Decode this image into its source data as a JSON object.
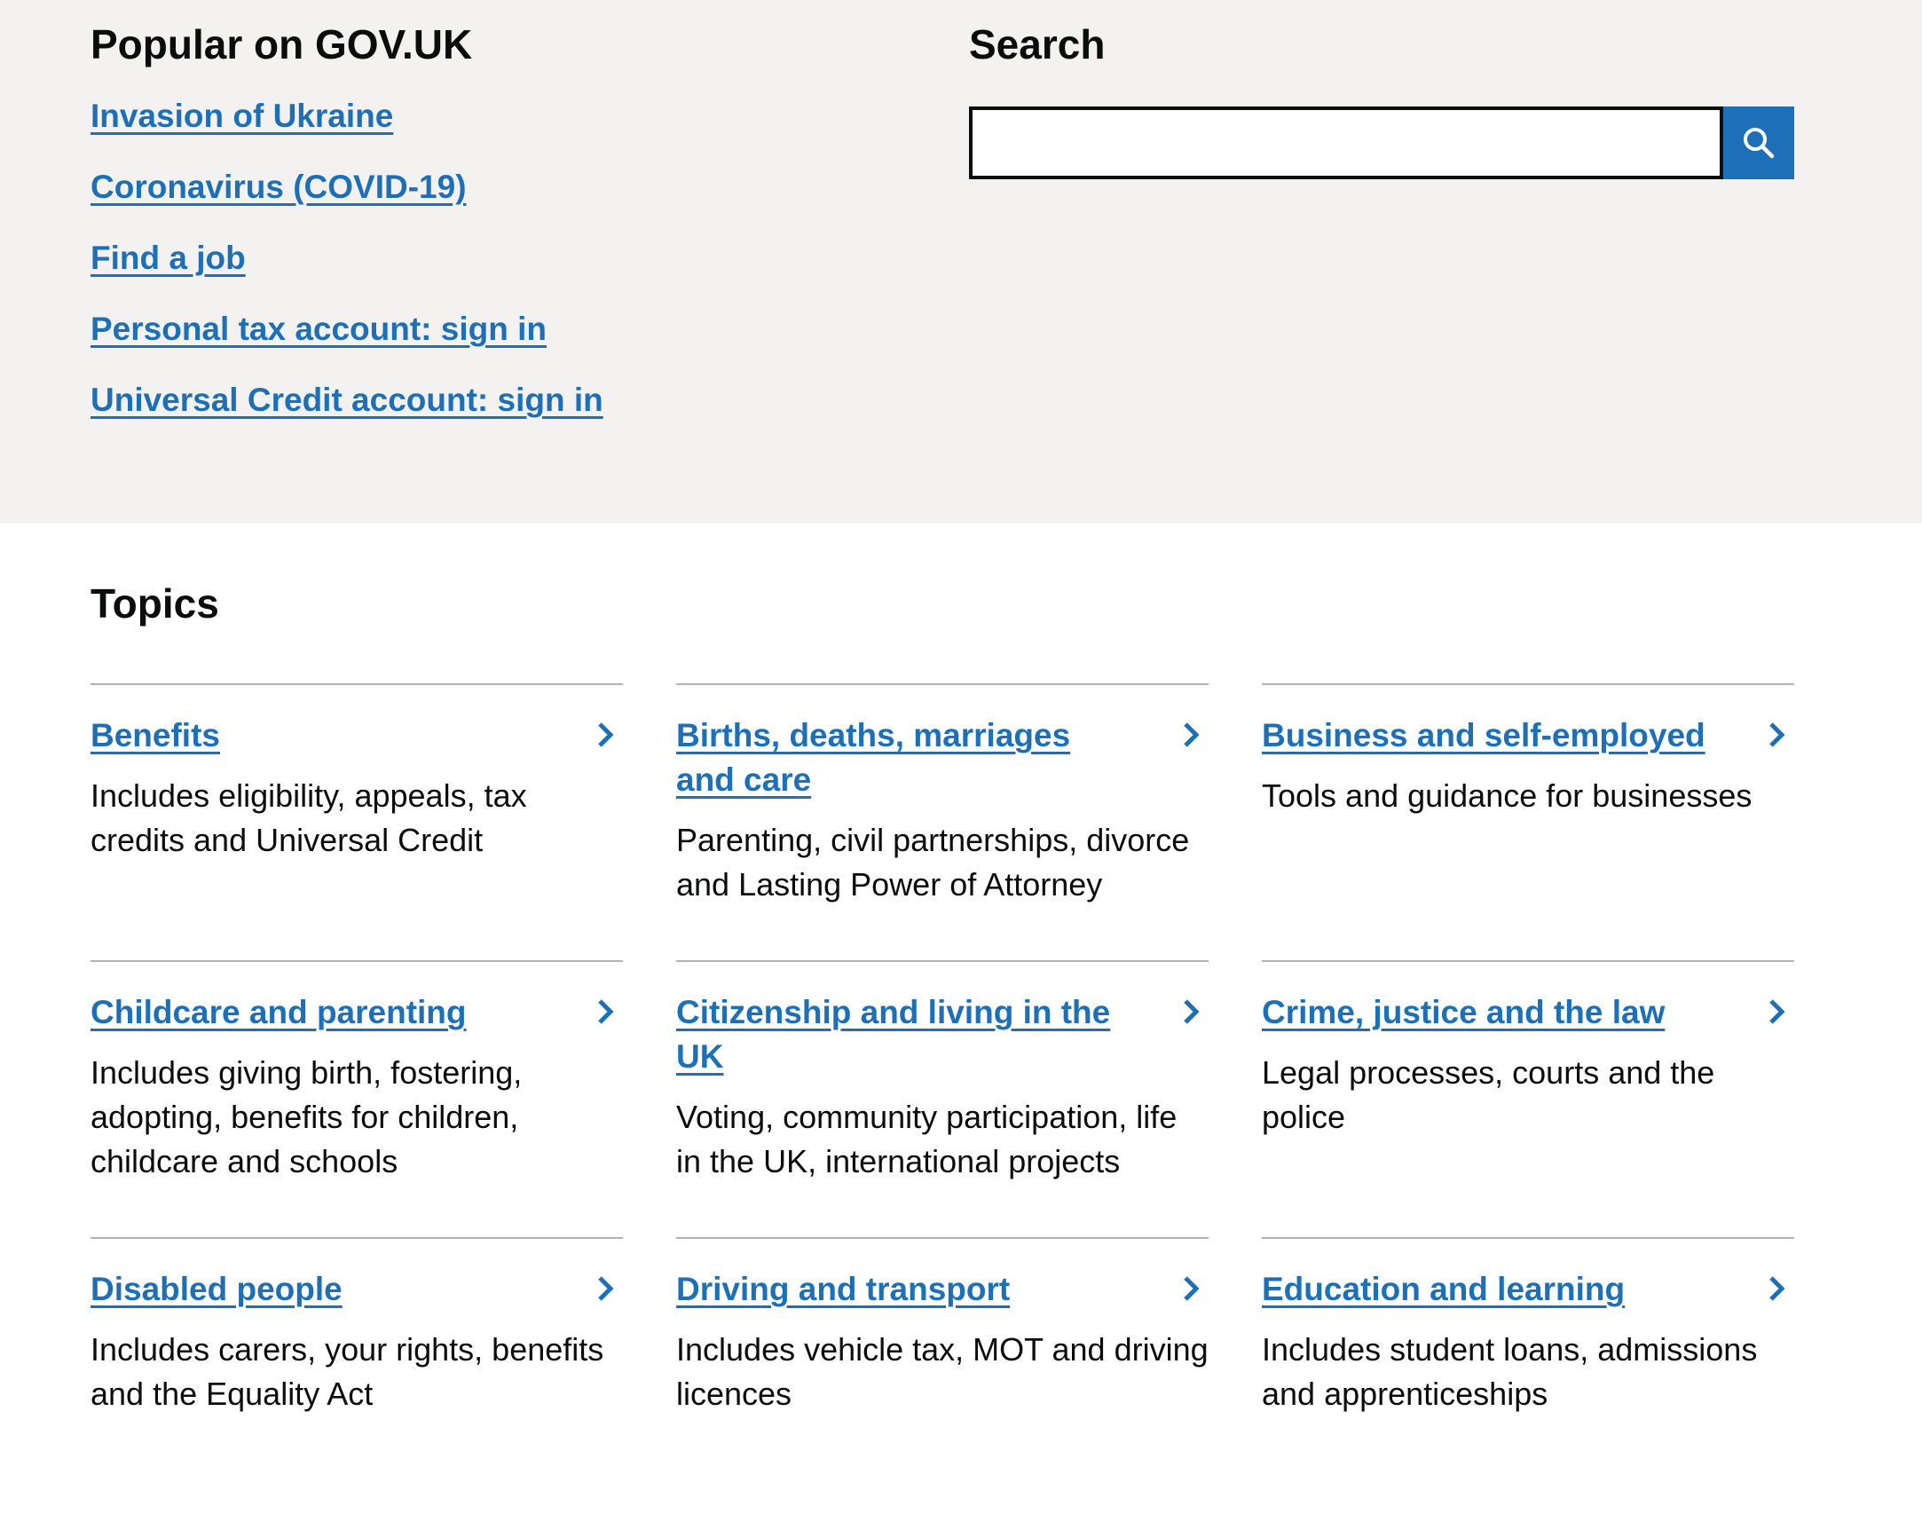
{
  "popular": {
    "title": "Popular on GOV.UK",
    "links": [
      {
        "label": "Invasion of Ukraine"
      },
      {
        "label": "Coronavirus (COVID-19)"
      },
      {
        "label": "Find a job"
      },
      {
        "label": "Personal tax account: sign in"
      },
      {
        "label": "Universal Credit account: sign in"
      }
    ]
  },
  "search": {
    "title": "Search",
    "input_value": "",
    "button_icon": "search-icon"
  },
  "topics": {
    "title": "Topics",
    "items": [
      {
        "title": "Benefits",
        "description": "Includes eligibility, appeals, tax credits and Universal Credit"
      },
      {
        "title": "Births, deaths, marriages and care",
        "description": "Parenting, civil partnerships, divorce and Lasting Power of Attorney"
      },
      {
        "title": "Business and self-employed",
        "description": "Tools and guidance for businesses"
      },
      {
        "title": "Childcare and parenting",
        "description": "Includes giving birth, fostering, adopting, benefits for children, childcare and schools"
      },
      {
        "title": "Citizenship and living in the UK",
        "description": "Voting, community participation, life in the UK, international projects"
      },
      {
        "title": "Crime, justice and the law",
        "description": "Legal processes, courts and the police"
      },
      {
        "title": "Disabled people",
        "description": "Includes carers, your rights, benefits and the Equality Act"
      },
      {
        "title": "Driving and transport",
        "description": "Includes vehicle tax, MOT and driving licences"
      },
      {
        "title": "Education and learning",
        "description": "Includes student loans, admissions and apprenticeships"
      }
    ]
  },
  "colors": {
    "link": "#1d70b8",
    "text": "#0b0c0c",
    "band": "#f3f2f1",
    "divider": "#b1b4b6"
  }
}
